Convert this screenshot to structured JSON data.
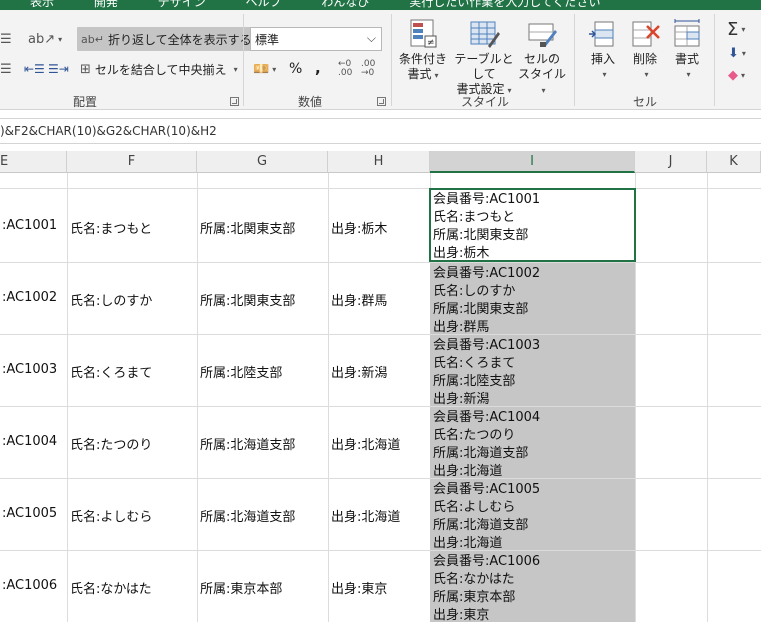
{
  "menu": [
    "表示",
    "開発",
    "デザイン",
    "ヘルプ",
    "わんなび",
    "実行したい作業を入力してください"
  ],
  "ribbon": {
    "alignment": {
      "wrap_text": "折り返して全体を表示する",
      "merge_center": "セルを結合して中央揃え",
      "label": "配置"
    },
    "number": {
      "format": "標準",
      "percent": "%",
      "comma": ",",
      "label": "数値"
    },
    "styles": {
      "conditional": [
        "条件付き",
        "書式"
      ],
      "table": [
        "テーブルとして",
        "書式設定"
      ],
      "cell_style": [
        "セルの",
        "スタイル"
      ],
      "label": "スタイル"
    },
    "cells": {
      "insert": "挿入",
      "delete": "削除",
      "format": "書式",
      "label": "セル"
    },
    "editing": {
      "sum": "Σ"
    }
  },
  "formula": ")&F2&CHAR(10)&G2&CHAR(10)&H2",
  "columns": [
    "E",
    "F",
    "G",
    "H",
    "I",
    "J",
    "K"
  ],
  "rows": [
    {
      "e": ":AC1001",
      "f": "氏名:まつもと",
      "g": "所属:北関東支部",
      "h": "出身:栃木",
      "i": [
        "会員番号:AC1001",
        "氏名:まつもと",
        "所属:北関東支部",
        "出身:栃木"
      ]
    },
    {
      "e": ":AC1002",
      "f": "氏名:しのすか",
      "g": "所属:北関東支部",
      "h": "出身:群馬",
      "i": [
        "会員番号:AC1002",
        "氏名:しのすか",
        "所属:北関東支部",
        "出身:群馬"
      ]
    },
    {
      "e": ":AC1003",
      "f": "氏名:くろまて",
      "g": "所属:北陸支部",
      "h": "出身:新潟",
      "i": [
        "会員番号:AC1003",
        "氏名:くろまて",
        "所属:北陸支部",
        "出身:新潟"
      ]
    },
    {
      "e": ":AC1004",
      "f": "氏名:たつのり",
      "g": "所属:北海道支部",
      "h": "出身:北海道",
      "i": [
        "会員番号:AC1004",
        "氏名:たつのり",
        "所属:北海道支部",
        "出身:北海道"
      ]
    },
    {
      "e": ":AC1005",
      "f": "氏名:よしむら",
      "g": "所属:北海道支部",
      "h": "出身:北海道",
      "i": [
        "会員番号:AC1005",
        "氏名:よしむら",
        "所属:北海道支部",
        "出身:北海道"
      ]
    },
    {
      "e": ":AC1006",
      "f": "氏名:なかはた",
      "g": "所属:東京本部",
      "h": "出身:東京",
      "i": [
        "会員番号:AC1006",
        "氏名:なかはた",
        "所属:東京本部",
        "出身:東京"
      ]
    }
  ],
  "colors": {
    "accent": "#217346",
    "selected_fill": "#c6c6c6"
  }
}
